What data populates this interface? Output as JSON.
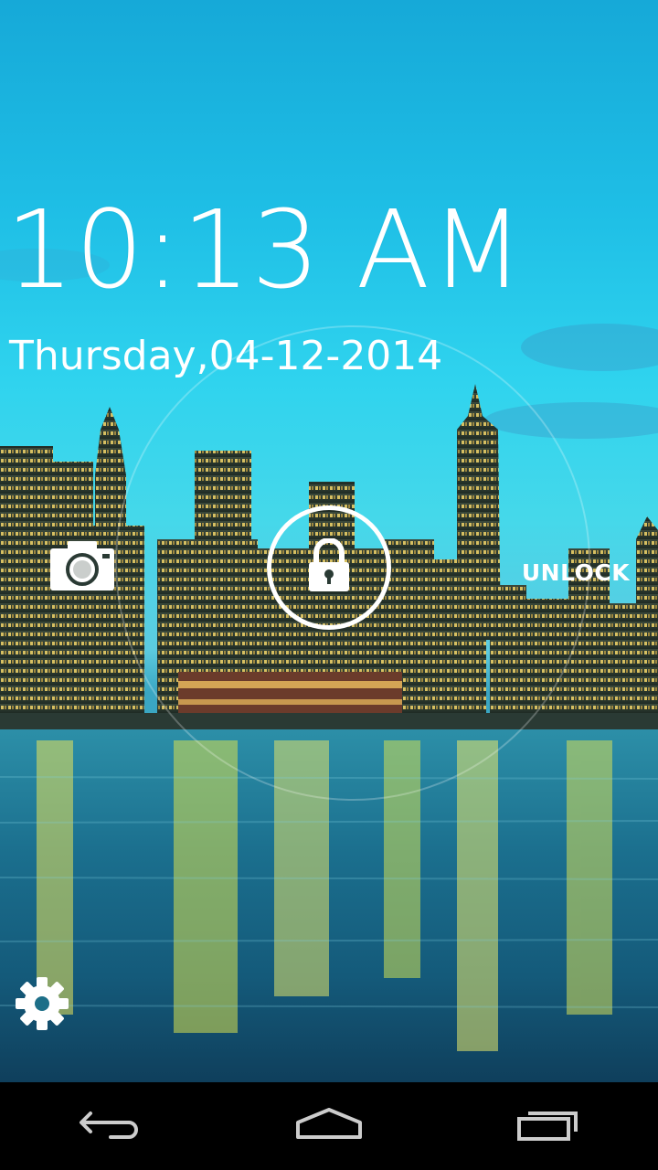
{
  "lockscreen": {
    "time": "10:13 AM",
    "date": "Thursday,04-12-2014",
    "unlock_label": "UNLOCK"
  },
  "icons": {
    "camera": "camera-icon",
    "lock": "padlock-icon",
    "settings": "gear-icon",
    "nav_back": "back-icon",
    "nav_home": "home-icon",
    "nav_recents": "recents-icon"
  },
  "colors": {
    "foreground": "#ffffff",
    "nav_bar": "#000000",
    "nav_icon": "#cccccc"
  }
}
